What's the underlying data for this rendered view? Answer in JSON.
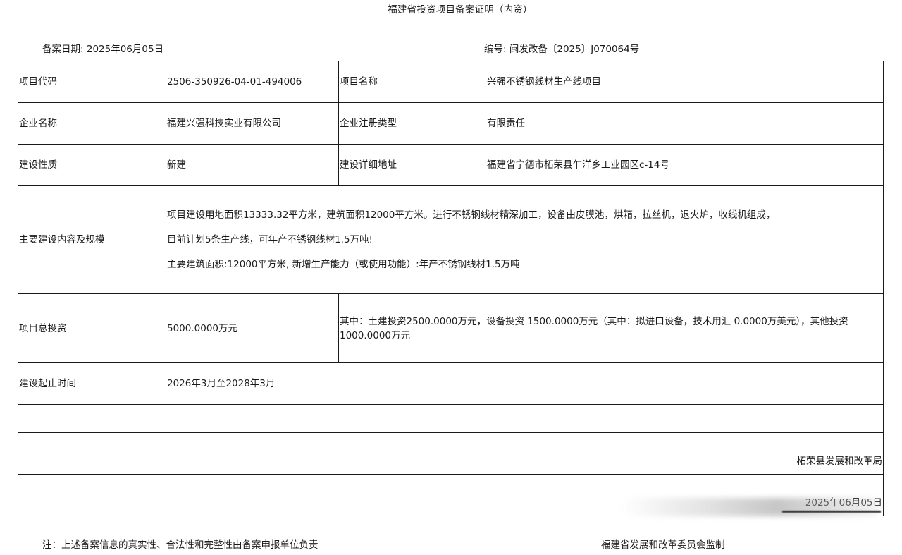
{
  "header": {
    "title": "福建省投资项目备案证明（内资）",
    "date_label": "备案日期:",
    "date_value": "2025年06月05日",
    "number_label": "编号:",
    "number_value": "闽发改备〔2025〕J070064号"
  },
  "table": {
    "project_code_label": "项目代码",
    "project_code_value": "2506-350926-04-01-494006",
    "project_name_label": "项目名称",
    "project_name_value": "兴强不锈钢线材生产线项目",
    "company_name_label": "企业名称",
    "company_name_value": "福建兴强科技实业有限公司",
    "registration_type_label": "企业注册类型",
    "registration_type_value": "有限责任",
    "construction_nature_label": "建设性质",
    "construction_nature_value": "新建",
    "address_label": "建设详细地址",
    "address_value": "福建省宁德市柘荣县乍洋乡工业园区c-14号",
    "scale_label": "主要建设内容及规模",
    "scale_line1": "项目建设用地面积13333.32平方米，建筑面积12000平方米。进行不锈钢线材精深加工，设备由皮膜池，烘箱，拉丝机，退火炉，收线机组成，",
    "scale_line2": "目前计划5条生产线，可年产不锈钢线材1.5万吨!",
    "scale_line3": "主要建筑面积:12000平方米, 新增生产能力（或使用功能）:年产不锈钢线材1.5万吨",
    "investment_label": "项目总投资",
    "investment_value": "5000.0000万元",
    "investment_detail": "其中：土建投资2500.0000万元，设备投资 1500.0000万元（其中：拟进口设备，技术用汇 0.0000万美元），其他投资1000.0000万元",
    "period_label": "建设起止时间",
    "period_value": "2026年3月至2028年3月",
    "authority": "柘荣县发展和改革局",
    "issue_date": "2025年06月05日"
  },
  "footer": {
    "note": "注：上述备案信息的真实性、合法性和完整性由备案申报单位负责",
    "supervision": "福建省发展和改革委员会监制"
  }
}
